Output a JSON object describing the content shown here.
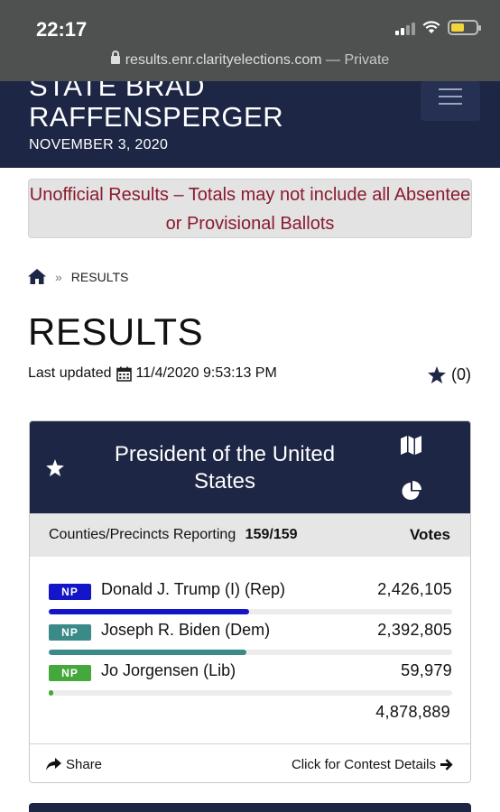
{
  "status_bar": {
    "time": "22:17"
  },
  "browser": {
    "url": "results.enr.clarityelections.com",
    "separator": "—",
    "mode": "Private"
  },
  "header": {
    "title_line1": "STATE BRAD",
    "title_line2": "RAFFENSPERGER",
    "date": "NOVEMBER 3, 2020",
    "menu_icon": "hamburger-icon"
  },
  "banner": {
    "text": "Unofficial Results – Totals may not include all Absentee or Provisional Ballots",
    "color": "#8b1a2e"
  },
  "breadcrumb": {
    "home_icon": "home-icon",
    "separator": "»",
    "current": "RESULTS"
  },
  "page": {
    "title": "RESULTS",
    "updated_label": "Last updated",
    "updated_value": "11/4/2020 9:53:13 PM",
    "favorites": "(0)"
  },
  "contest": {
    "title": "President of the United States",
    "reporting_label": "Counties/Precincts Reporting",
    "reporting_value": "159/159",
    "votes_header": "Votes",
    "candidates": [
      {
        "badge": "NP",
        "name": "Donald J. Trump (I) (Rep)",
        "votes": "2,426,105",
        "share": 49.73,
        "color": "#1414c8"
      },
      {
        "badge": "NP",
        "name": "Joseph R. Biden (Dem)",
        "votes": "2,392,805",
        "share": 49.04,
        "color": "#3a8a88"
      },
      {
        "badge": "NP",
        "name": "Jo Jorgensen (Lib)",
        "votes": "59,979",
        "share": 1.23,
        "color": "#44a83a"
      }
    ],
    "total_votes": "4,878,889",
    "share_label": "Share",
    "details_label": "Click for Contest Details"
  },
  "colors": {
    "header_bg": "#1d2645",
    "status_bar_bg": "#4f5050"
  }
}
